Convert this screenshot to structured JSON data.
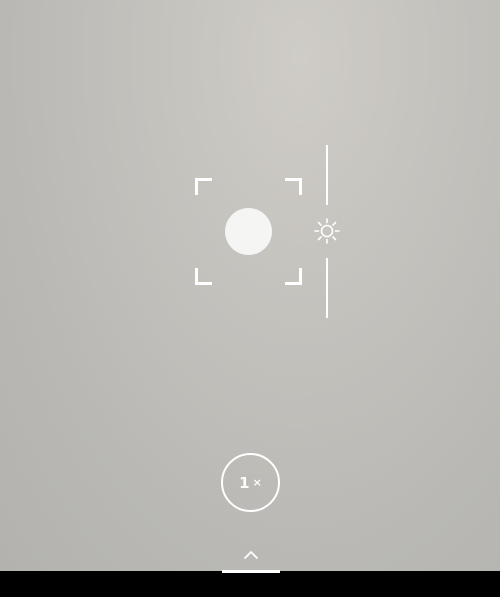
{
  "viewfinder": {
    "zoom": {
      "value": "1",
      "unit": "×"
    },
    "icons": {
      "exposure": "sun-icon",
      "drawer": "chevron-up-icon"
    }
  },
  "mode_bar": {
    "modes": [
      {
        "label": ""
      },
      {
        "label": ""
      },
      {
        "label": ""
      }
    ],
    "active_index": 1
  },
  "colors": {
    "overlay": "#ffffff",
    "bar": "#000000"
  }
}
